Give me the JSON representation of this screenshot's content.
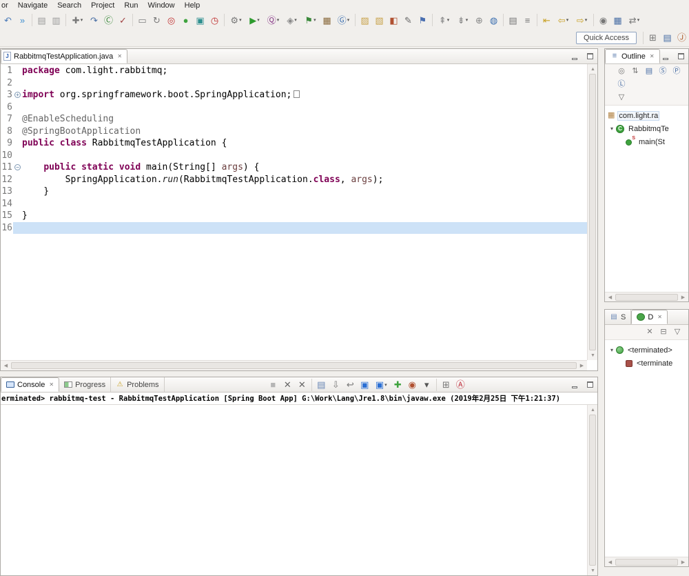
{
  "ui": {
    "close_glyph": "✕",
    "dropdown_glyph": "▾",
    "chevron_glyph": "▾",
    "up_glyph": "▲",
    "down_glyph": "▼",
    "left_glyph": "◀",
    "right_glyph": "▶"
  },
  "menubar": {
    "items": [
      "or",
      "Navigate",
      "Search",
      "Project",
      "Run",
      "Window",
      "Help"
    ]
  },
  "toolbar": {
    "quick_access_label": "Quick Access",
    "row1_icons": [
      {
        "name": "back-nav-icon",
        "glyph": "↶",
        "color": "#4a7ab8"
      },
      {
        "name": "resume-icon",
        "glyph": "»",
        "color": "#3f8fd0"
      },
      {
        "sep": true
      },
      {
        "name": "save-icon",
        "glyph": "▤",
        "color": "#9b9b9b"
      },
      {
        "name": "save-all-icon",
        "glyph": "▥",
        "color": "#9b9b9b"
      },
      {
        "sep": true
      },
      {
        "name": "new-wizard-icon",
        "glyph": "✚",
        "color": "#7a7a7a",
        "dd": true
      },
      {
        "name": "step-commands-icon",
        "glyph": "↷",
        "color": "#4a6fa5"
      },
      {
        "name": "new-class-icon",
        "glyph": "Ⓒ",
        "color": "#3c8a3c"
      },
      {
        "name": "junit-icon",
        "glyph": "✓",
        "color": "#a04040"
      },
      {
        "sep": true
      },
      {
        "name": "print-icon",
        "glyph": "▭",
        "color": "#808080"
      },
      {
        "name": "refresh-icon",
        "glyph": "↻",
        "color": "#7a7a7a"
      },
      {
        "name": "target-platform-icon",
        "glyph": "◎",
        "color": "#c03030"
      },
      {
        "name": "start-server-icon",
        "glyph": "●",
        "color": "#3fa33f"
      },
      {
        "name": "terminal-icon",
        "glyph": "▣",
        "color": "#2e8f8f"
      },
      {
        "name": "scheduler-icon",
        "glyph": "◷",
        "color": "#c03030"
      },
      {
        "sep": true
      },
      {
        "name": "build-gear-icon",
        "glyph": "⚙",
        "color": "#777777",
        "dd": true
      },
      {
        "name": "run-icon",
        "glyph": "▶",
        "color": "#2e9b2e",
        "dd": true
      },
      {
        "name": "data-query-icon",
        "glyph": "Ⓠ",
        "color": "#8a3c8a",
        "dd": true
      },
      {
        "name": "external-tools-icon",
        "glyph": "◈",
        "color": "#888888",
        "dd": true
      },
      {
        "name": "coverage-icon",
        "glyph": "⚑",
        "color": "#3c8a3c",
        "dd": true
      },
      {
        "name": "new-database-table-icon",
        "glyph": "▦",
        "color": "#8a6a3c"
      },
      {
        "name": "web-browser-icon",
        "glyph": "Ⓖ",
        "color": "#3c6fb0",
        "dd": true
      },
      {
        "sep": true
      },
      {
        "name": "open-folder-icon",
        "glyph": "▨",
        "color": "#c8a24a"
      },
      {
        "name": "export-folder-icon",
        "glyph": "▧",
        "color": "#c8a24a"
      },
      {
        "name": "fill-color-icon",
        "glyph": "◧",
        "color": "#b05030"
      },
      {
        "name": "edit-pencil-icon",
        "glyph": "✎",
        "color": "#666666"
      },
      {
        "name": "bookmark-flag-icon",
        "glyph": "⚑",
        "color": "#4a6fb0"
      },
      {
        "sep": true
      },
      {
        "name": "previous-annotation-icon",
        "glyph": "⇞",
        "color": "#888888",
        "dd": true
      },
      {
        "name": "next-annotation-icon",
        "glyph": "⇟",
        "color": "#888888",
        "dd": true
      },
      {
        "name": "link-item-icon",
        "glyph": "⊕",
        "color": "#888888"
      },
      {
        "name": "world-icon",
        "glyph": "◍",
        "color": "#3c6fb0"
      },
      {
        "sep": true
      },
      {
        "name": "task-list-icon",
        "glyph": "▤",
        "color": "#777777"
      },
      {
        "name": "mark-occurrences-icon",
        "glyph": "≡",
        "color": "#777777"
      },
      {
        "sep": true
      },
      {
        "name": "last-edit-location-icon",
        "glyph": "⇤",
        "color": "#c9a227"
      },
      {
        "name": "back-icon",
        "glyph": "⇦",
        "color": "#c9a227",
        "dd": true
      },
      {
        "name": "forward-icon",
        "glyph": "⇨",
        "color": "#c9a227",
        "dd": true
      },
      {
        "sep": true
      },
      {
        "name": "pin-editor-icon",
        "glyph": "◉",
        "color": "#777777"
      },
      {
        "name": "table-view-icon",
        "glyph": "▦",
        "color": "#4a6fa5"
      },
      {
        "name": "sync-icon",
        "glyph": "⇄",
        "color": "#777777",
        "dd": true
      }
    ],
    "row2_icons": [
      {
        "name": "open-perspective-icon",
        "glyph": "⊞",
        "color": "#777777"
      },
      {
        "name": "java-ee-perspective-icon",
        "glyph": "▤",
        "color": "#4a6fa5"
      },
      {
        "name": "java-perspective-icon",
        "glyph": "Ⓙ",
        "color": "#b06030"
      }
    ]
  },
  "editor": {
    "tab_label": "RabbitmqTestApplication.java",
    "tab_icon_glyph": "J",
    "lines": [
      {
        "num": "1",
        "segments": [
          {
            "text": "package",
            "style": "kw"
          },
          {
            "text": " com.light.rabbitmq;",
            "style": "plain"
          }
        ]
      },
      {
        "num": "2",
        "segments": []
      },
      {
        "num": "3",
        "fold": "plus",
        "fold_box": true,
        "segments": [
          {
            "text": "import",
            "style": "kw"
          },
          {
            "text": " org.springframework.boot.SpringApplication;",
            "style": "plain"
          }
        ]
      },
      {
        "num": "6",
        "segments": []
      },
      {
        "num": "7",
        "segments": [
          {
            "text": "@EnableScheduling",
            "style": "ann"
          }
        ]
      },
      {
        "num": "8",
        "segments": [
          {
            "text": "@SpringBootApplication",
            "style": "ann"
          }
        ]
      },
      {
        "num": "9",
        "segments": [
          {
            "text": "public class",
            "style": "kw"
          },
          {
            "text": " RabbitmqTestApplication {",
            "style": "plain"
          }
        ]
      },
      {
        "num": "10",
        "segments": []
      },
      {
        "num": "11",
        "fold": "minus",
        "segments": [
          {
            "text": "    ",
            "style": "plain"
          },
          {
            "text": "public static void",
            "style": "kw"
          },
          {
            "text": " main(String[] ",
            "style": "plain"
          },
          {
            "text": "args",
            "style": "param"
          },
          {
            "text": ") {",
            "style": "plain"
          }
        ]
      },
      {
        "num": "12",
        "segments": [
          {
            "text": "        SpringApplication.",
            "style": "plain"
          },
          {
            "text": "run",
            "style": "staticm"
          },
          {
            "text": "(RabbitmqTestApplication.",
            "style": "plain"
          },
          {
            "text": "class",
            "style": "kw"
          },
          {
            "text": ", ",
            "style": "plain"
          },
          {
            "text": "args",
            "style": "param"
          },
          {
            "text": ");",
            "style": "plain"
          }
        ]
      },
      {
        "num": "13",
        "segments": [
          {
            "text": "    }",
            "style": "plain"
          }
        ]
      },
      {
        "num": "14",
        "segments": []
      },
      {
        "num": "15",
        "segments": [
          {
            "text": "}",
            "style": "plain"
          }
        ]
      },
      {
        "num": "16",
        "current": true,
        "segments": []
      }
    ]
  },
  "outline": {
    "tab_label": "Outline",
    "tab_icon_glyph": "≡",
    "toolbar_rows": [
      [
        {
          "name": "focus-active-task-icon",
          "glyph": "◎",
          "color": "#777777"
        },
        {
          "name": "sort-icon",
          "glyph": "⇅",
          "color": "#777777"
        },
        {
          "name": "hide-fields-icon",
          "glyph": "▤",
          "color": "#4a6fa5"
        },
        {
          "name": "hide-static-members-icon",
          "glyph": "Ⓢ",
          "color": "#4a6fa5"
        },
        {
          "name": "hide-non-public-members-icon",
          "glyph": "Ⓟ",
          "color": "#4a6fa5"
        }
      ],
      [
        {
          "name": "hide-local-types-icon",
          "glyph": "Ⓛ",
          "color": "#4a6fa5"
        }
      ],
      [
        {
          "name": "outline-view-menu-icon",
          "glyph": "▽",
          "color": "#666666"
        }
      ]
    ],
    "tree": [
      {
        "name": "outline-item-package",
        "icon": "package-icon",
        "glyph": "▦",
        "label": "com.light.ra",
        "indent": 0,
        "selected": true
      },
      {
        "name": "outline-item-class",
        "icon": "class-icon",
        "glyph": "C",
        "label": "RabbitmqTe",
        "indent": 0,
        "chevron": true
      },
      {
        "name": "outline-item-main-method",
        "icon": "static-method-icon",
        "glyph": "S",
        "label": "main(St",
        "indent": 2
      }
    ]
  },
  "debug": {
    "tabs": [
      {
        "name": "tab-servers",
        "label": "S",
        "icon": "servers-icon",
        "glyph": "▤",
        "color": "#6a87b5"
      },
      {
        "name": "tab-debug",
        "label": "D",
        "icon": "debug-icon",
        "selected": true
      }
    ],
    "toolbar": [
      {
        "name": "remove-all-terminated-icon",
        "glyph": "✕",
        "color": "#777777"
      },
      {
        "name": "collapse-all-icon",
        "glyph": "⊟",
        "color": "#777777"
      },
      {
        "name": "debug-view-menu-icon",
        "glyph": "▽",
        "color": "#666666"
      }
    ],
    "tree": [
      {
        "name": "debug-item-launch",
        "icon": "launch-terminated-icon",
        "label": "<terminated>",
        "indent": 0,
        "chevron": true
      },
      {
        "name": "debug-item-process",
        "icon": "process-terminated-icon",
        "label": "<terminate",
        "indent": 2
      }
    ]
  },
  "console": {
    "tabs": [
      {
        "name": "tab-console",
        "label": "Console",
        "icon": "console-icon",
        "selected": true
      },
      {
        "name": "tab-progress",
        "label": "Progress",
        "icon": "progress-icon"
      },
      {
        "name": "tab-problems",
        "label": "Problems",
        "icon": "problems-icon",
        "glyph": "⚠",
        "color": "#c9a227"
      }
    ],
    "toolbar_icons": [
      {
        "name": "terminate-icon",
        "glyph": "■",
        "color": "#b5b5b5"
      },
      {
        "name": "remove-launch-icon",
        "glyph": "✕",
        "color": "#666666"
      },
      {
        "name": "remove-all-launches-icon",
        "glyph": "✕",
        "color": "#666666"
      },
      {
        "sep": true
      },
      {
        "name": "clear-console-icon",
        "glyph": "▤",
        "color": "#6a87b5"
      },
      {
        "name": "scroll-lock-icon",
        "glyph": "⇩",
        "color": "#777777"
      },
      {
        "name": "word-wrap-icon",
        "glyph": "↩",
        "color": "#777777"
      },
      {
        "name": "display-selected-console-icon",
        "glyph": "▣",
        "color": "#2b6fd4"
      },
      {
        "name": "open-console-icon",
        "glyph": "▣",
        "color": "#2b6fd4",
        "dd": true
      },
      {
        "name": "new-console-view-icon",
        "glyph": "✚",
        "color": "#3fa33f"
      },
      {
        "name": "pin-console-icon",
        "glyph": "◉",
        "color": "#b05030"
      },
      {
        "name": "console-settings-icon",
        "glyph": "▾",
        "color": "#555555"
      },
      {
        "sep": true
      },
      {
        "name": "detach-view-icon",
        "glyph": "⊞",
        "color": "#777777"
      },
      {
        "name": "annotation-icon",
        "glyph": "Ⓐ",
        "color": "#c03340"
      }
    ],
    "status_line": "erminated> rabbitmq-test - RabbitmqTestApplication [Spring Boot App] G:\\Work\\Lang\\Jre1.8\\bin\\javaw.exe (2019年2月25日 下午1:21:37)"
  },
  "colors": {
    "keyword": "#7f0055",
    "annotation": "#646464",
    "current_line": "#cde2f7"
  }
}
